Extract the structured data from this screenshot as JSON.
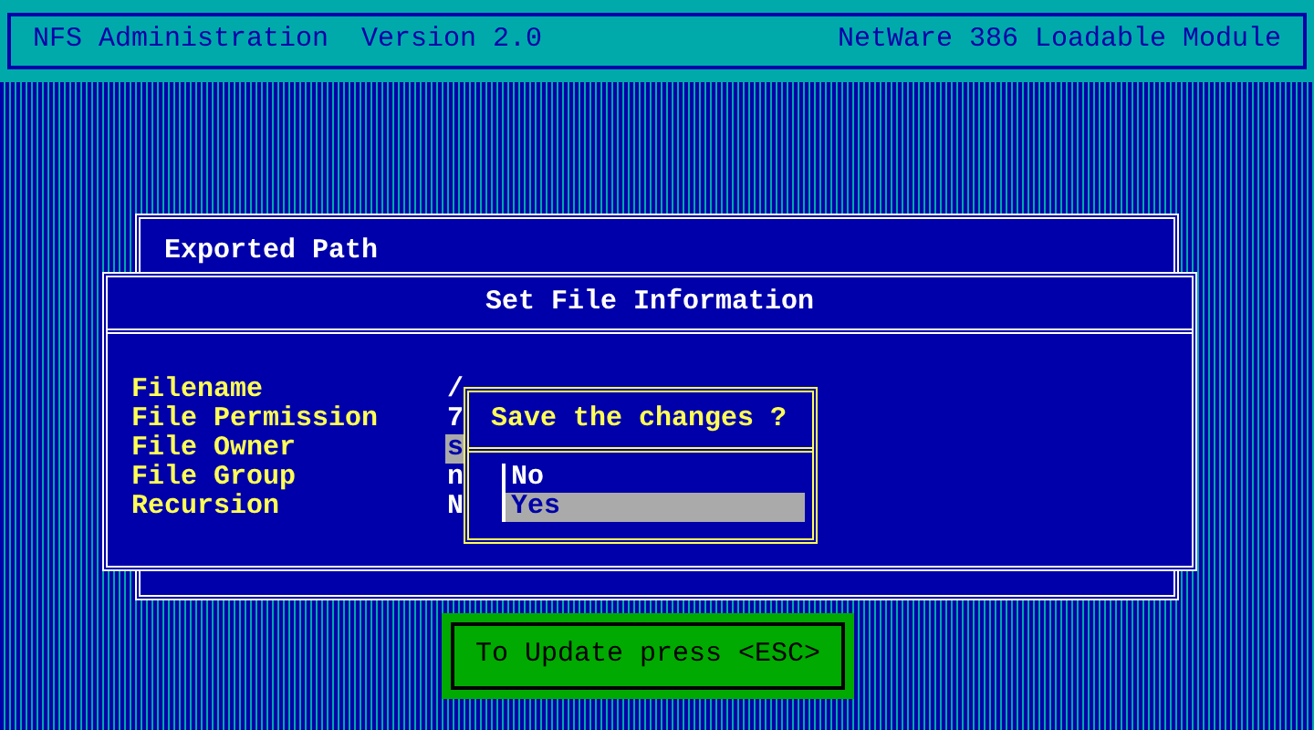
{
  "header": {
    "title": "NFS Administration  Version 2.0",
    "module": "NetWare 386 Loadable Module"
  },
  "exported_path": {
    "title": "Exported Path"
  },
  "file_info": {
    "title": "Set File Information",
    "fields": [
      {
        "label": "Filename",
        "value": "/",
        "cursor": false
      },
      {
        "label": "File Permission",
        "value": "7",
        "cursor": false
      },
      {
        "label": "File Owner",
        "value": "s",
        "cursor": true
      },
      {
        "label": "File Group",
        "value": "n",
        "cursor": false
      },
      {
        "label": "Recursion",
        "value": "N",
        "cursor": false
      }
    ]
  },
  "confirm": {
    "title": "Save the changes ?",
    "options": [
      {
        "label": "No",
        "selected": false
      },
      {
        "label": "Yes",
        "selected": true
      }
    ]
  },
  "hint": "To Update press <ESC>"
}
